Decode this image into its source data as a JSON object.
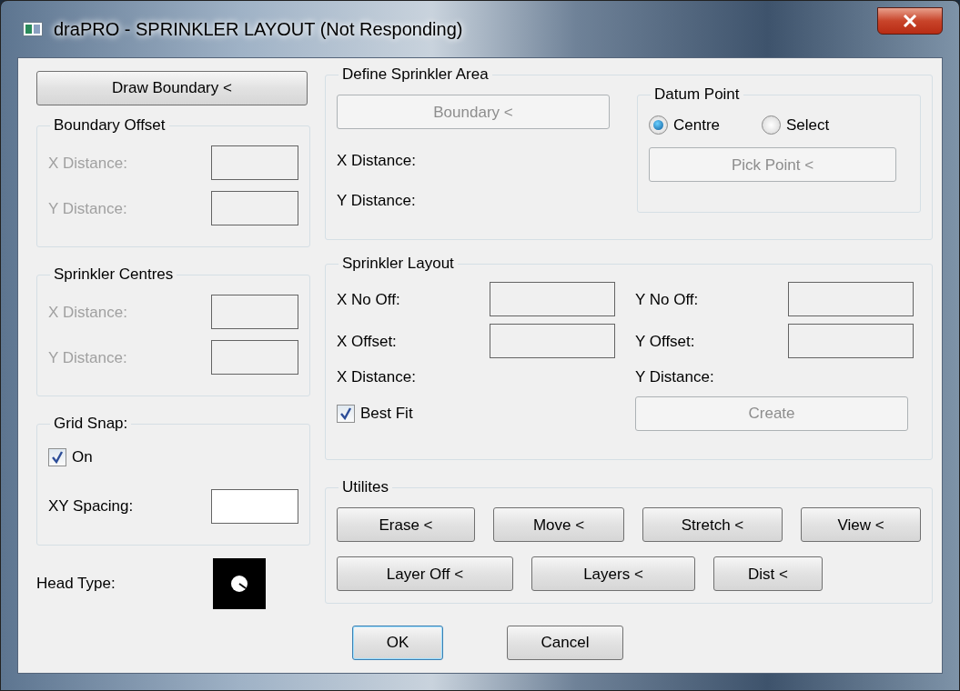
{
  "window": {
    "title": "draPRO - SPRINKLER LAYOUT (Not Responding)"
  },
  "draw_boundary_button": {
    "label": "Draw Boundary <",
    "disabled": false
  },
  "boundary_offset": {
    "title": "Boundary Offset",
    "fields": [
      {
        "label": "X Distance:",
        "disabled": true
      },
      {
        "label": "Y Distance:",
        "disabled": true
      }
    ]
  },
  "sprinkler_centres": {
    "title": "Sprinkler Centres",
    "fields": [
      {
        "label": "X Distance:",
        "disabled": true
      },
      {
        "label": "Y Distance:",
        "disabled": true
      }
    ]
  },
  "grid_snap": {
    "title": "Grid Snap:",
    "checkbox": {
      "label": "On",
      "checked": true
    },
    "field": {
      "label": "XY Spacing:",
      "disabled": false
    }
  },
  "head_type": {
    "label": "Head Type:"
  },
  "define_area": {
    "title": "Define Sprinkler Area",
    "button": {
      "label": "Boundary <",
      "disabled": true
    },
    "readouts": [
      "X Distance:",
      "Y Distance:"
    ],
    "datum": {
      "title": "Datum Point",
      "options": [
        {
          "label": "Centre",
          "selected": true
        },
        {
          "label": "Select",
          "selected": false
        }
      ],
      "button": {
        "label": "Pick Point <",
        "disabled": true
      }
    }
  },
  "sprinkler_layout": {
    "title": "Sprinkler Layout",
    "fields": [
      {
        "label": "X No Off:",
        "disabled": true
      },
      {
        "label": "Y No Off:",
        "disabled": true
      },
      {
        "label": "X Offset:",
        "disabled": true
      },
      {
        "label": "Y Offset:",
        "disabled": true
      }
    ],
    "readouts": [
      "X Distance:",
      "Y Distance:"
    ],
    "checkbox": {
      "label": "Best Fit",
      "checked": true
    },
    "button": {
      "label": "Create",
      "disabled": true
    }
  },
  "utilities": {
    "title": "Utilites",
    "rows": [
      [
        {
          "label": "Erase <"
        },
        {
          "label": "Move <"
        },
        {
          "label": "Stretch <"
        },
        {
          "label": "View <"
        }
      ],
      [
        {
          "label": "Layer Off <"
        },
        {
          "label": "Layers <"
        },
        {
          "label": "Dist <"
        }
      ]
    ]
  },
  "buttons": [
    {
      "label": "OK",
      "focused": true
    },
    {
      "label": "Cancel",
      "focused": false
    }
  ]
}
